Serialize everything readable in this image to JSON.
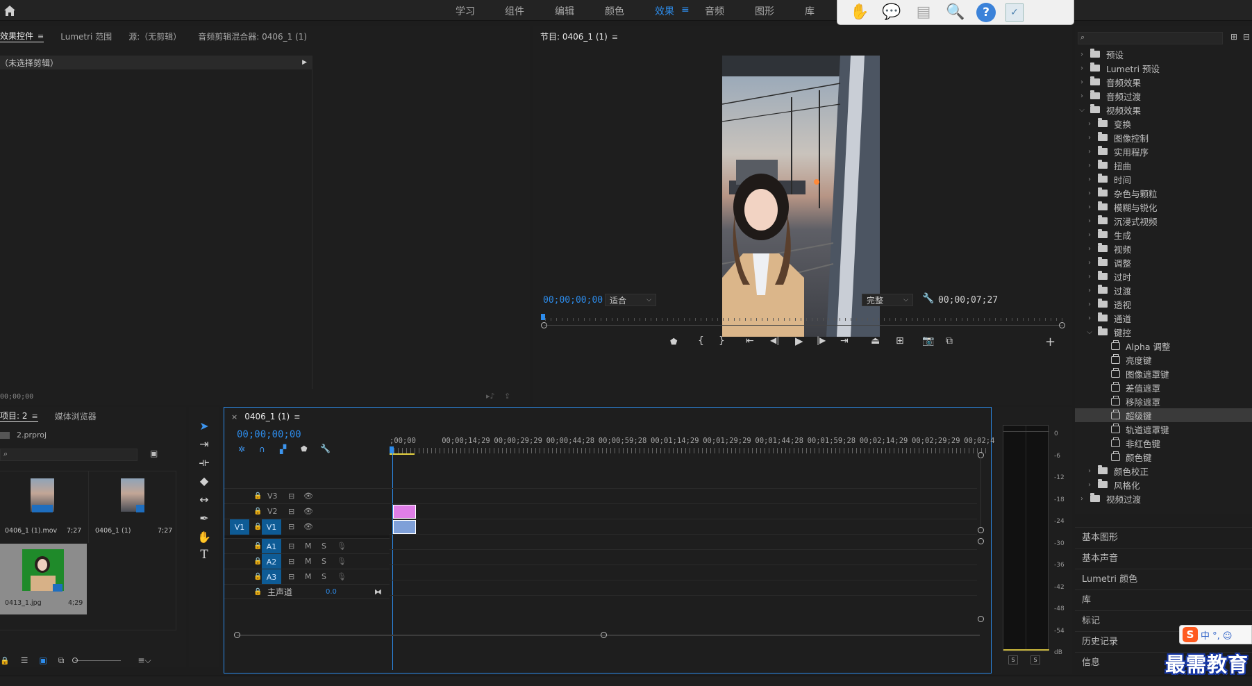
{
  "workspaces": [
    "学习",
    "组件",
    "编辑",
    "颜色",
    "效果",
    "音频",
    "图形",
    "库"
  ],
  "active_workspace": "效果",
  "effect_controls": {
    "tabs": [
      "效果控件",
      "Lumetri 范围",
      "源:（无剪辑）",
      "音频剪辑混合器: 0406_1 (1)"
    ],
    "no_clip": "（未选择剪辑）",
    "timecode": "00;00;00"
  },
  "program": {
    "title": "节目: 0406_1 (1)",
    "timecode": "00;00;00;00",
    "fit": "适合",
    "quality": "完整",
    "duration": "00;00;07;27"
  },
  "project": {
    "tabs": [
      "项目: 2",
      "媒体浏览器"
    ],
    "file": "2.prproj",
    "items": [
      {
        "name": "0406_1 (1).mov",
        "duration": "7;27"
      },
      {
        "name": "0406_1 (1)",
        "duration": "7;27"
      },
      {
        "name": "0413_1.jpg",
        "duration": "4;29"
      }
    ]
  },
  "timeline": {
    "title": "0406_1 (1)",
    "timecode": "00;00;00;00",
    "ruler": [
      ";00;00",
      "00;00;14;29",
      "00;00;29;29",
      "00;00;44;28",
      "00;00;59;28",
      "00;01;14;29",
      "00;01;29;29",
      "00;01;44;28",
      "00;01;59;28",
      "00;02;14;29",
      "00;02;29;29",
      "00;02;44;"
    ],
    "video_tracks": [
      "V3",
      "V2",
      "V1"
    ],
    "source_patch": "V1",
    "audio_tracks": [
      "A1",
      "A2",
      "A3"
    ],
    "mute": "M",
    "solo": "S",
    "master": "主声道",
    "master_value": "0.0",
    "clip_colors": {
      "v2": "#e07ee8",
      "v1": "#7fa0d8"
    }
  },
  "meter": {
    "labels": [
      "0",
      "-6",
      "-12",
      "-18",
      "-24",
      "-30",
      "-36",
      "-42",
      "-48",
      "-54",
      "dB"
    ],
    "solo": [
      "S",
      "S"
    ]
  },
  "effects_tree": [
    {
      "label": "预设",
      "depth": 0,
      "open": false,
      "icon": "preset"
    },
    {
      "label": "Lumetri 预设",
      "depth": 0,
      "open": false,
      "icon": "preset"
    },
    {
      "label": "音频效果",
      "depth": 0,
      "open": false,
      "icon": "folder"
    },
    {
      "label": "音频过渡",
      "depth": 0,
      "open": false,
      "icon": "folder"
    },
    {
      "label": "视频效果",
      "depth": 0,
      "open": true,
      "icon": "folder"
    },
    {
      "label": "变换",
      "depth": 1,
      "open": false,
      "icon": "folder"
    },
    {
      "label": "图像控制",
      "depth": 1,
      "open": false,
      "icon": "folder"
    },
    {
      "label": "实用程序",
      "depth": 1,
      "open": false,
      "icon": "folder"
    },
    {
      "label": "扭曲",
      "depth": 1,
      "open": false,
      "icon": "folder"
    },
    {
      "label": "时间",
      "depth": 1,
      "open": false,
      "icon": "folder"
    },
    {
      "label": "杂色与颗粒",
      "depth": 1,
      "open": false,
      "icon": "folder"
    },
    {
      "label": "模糊与锐化",
      "depth": 1,
      "open": false,
      "icon": "folder"
    },
    {
      "label": "沉浸式视频",
      "depth": 1,
      "open": false,
      "icon": "folder"
    },
    {
      "label": "生成",
      "depth": 1,
      "open": false,
      "icon": "folder"
    },
    {
      "label": "视频",
      "depth": 1,
      "open": false,
      "icon": "folder"
    },
    {
      "label": "调整",
      "depth": 1,
      "open": false,
      "icon": "folder"
    },
    {
      "label": "过时",
      "depth": 1,
      "open": false,
      "icon": "folder"
    },
    {
      "label": "过渡",
      "depth": 1,
      "open": false,
      "icon": "folder"
    },
    {
      "label": "透视",
      "depth": 1,
      "open": false,
      "icon": "folder"
    },
    {
      "label": "通道",
      "depth": 1,
      "open": false,
      "icon": "folder"
    },
    {
      "label": "键控",
      "depth": 1,
      "open": true,
      "icon": "folder"
    },
    {
      "label": "Alpha 调整",
      "depth": 2,
      "icon": "fx"
    },
    {
      "label": "亮度键",
      "depth": 2,
      "icon": "fx"
    },
    {
      "label": "图像遮罩键",
      "depth": 2,
      "icon": "fx"
    },
    {
      "label": "差值遮罩",
      "depth": 2,
      "icon": "fx"
    },
    {
      "label": "移除遮罩",
      "depth": 2,
      "icon": "fx"
    },
    {
      "label": "超级键",
      "depth": 2,
      "icon": "fx",
      "selected": true
    },
    {
      "label": "轨道遮罩键",
      "depth": 2,
      "icon": "fx"
    },
    {
      "label": "非红色键",
      "depth": 2,
      "icon": "fx"
    },
    {
      "label": "颜色键",
      "depth": 2,
      "icon": "fx"
    },
    {
      "label": "颜色校正",
      "depth": 1,
      "open": false,
      "icon": "folder"
    },
    {
      "label": "风格化",
      "depth": 1,
      "open": false,
      "icon": "folder"
    },
    {
      "label": "视频过渡",
      "depth": 0,
      "open": false,
      "icon": "folder"
    }
  ],
  "side_panels": [
    "基本图形",
    "基本声音",
    "Lumetri 颜色",
    "库",
    "标记",
    "历史记录",
    "信息"
  ],
  "ime": {
    "label": "中 °, ☺"
  },
  "watermark": "最需教育"
}
